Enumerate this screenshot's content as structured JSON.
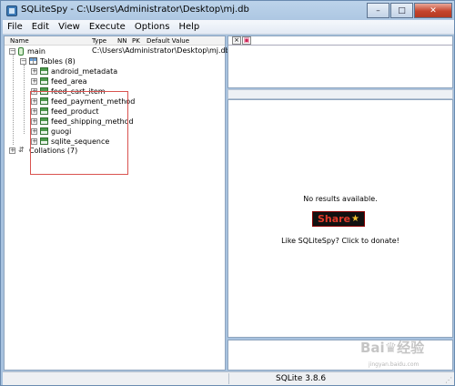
{
  "window": {
    "title": "SQLiteSpy - C:\\Users\\Administrator\\Desktop\\mj.db",
    "minimize_glyph": "–",
    "maximize_glyph": "□",
    "close_glyph": "✕"
  },
  "menu": [
    "File",
    "Edit",
    "View",
    "Execute",
    "Options",
    "Help"
  ],
  "tree": {
    "columns": [
      "Name",
      "Type",
      "NN",
      "PK",
      "Default Value"
    ],
    "db_name": "main",
    "db_path": "C:\\Users\\Administrator\\Desktop\\mj.db",
    "tables_label": "Tables (8)",
    "tables": [
      "android_metadata",
      "feed_area",
      "feed_cart_item",
      "feed_payment_method",
      "feed_product",
      "feed_shipping_method",
      "guogi",
      "sqlite_sequence"
    ],
    "collations_label": "Collations (7)"
  },
  "results": {
    "no_results": "No results available.",
    "share_label": "Share",
    "donate_text": "Like SQLiteSpy? Click to donate!"
  },
  "status": {
    "version": "SQLite 3.8.6"
  },
  "watermark": {
    "text": "Bai♛经验",
    "sub": "jingyan.baidu.com"
  },
  "colors": {
    "highlight_box": "#d9534f",
    "share_text": "#e23a2a"
  }
}
